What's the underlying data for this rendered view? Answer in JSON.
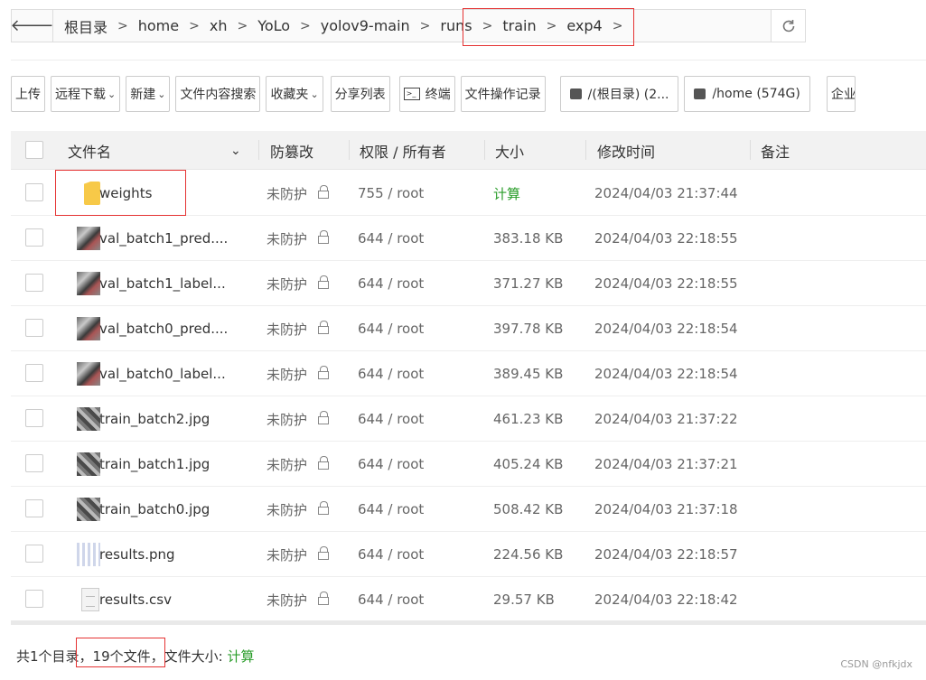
{
  "breadcrumb": {
    "items": [
      "根目录",
      "home",
      "xh",
      "YoLo",
      "yolov9-main",
      "runs",
      "train",
      "exp4"
    ]
  },
  "toolbar": {
    "upload": "上传",
    "remote_download": "远程下载",
    "new": "新建",
    "content_search": "文件内容搜索",
    "favorites": "收藏夹",
    "share_list": "分享列表",
    "terminal": "终端",
    "op_log": "文件操作记录",
    "disk_root": "/(根目录) (2...",
    "disk_home": "/home (574G)",
    "enterprise": "企业"
  },
  "table": {
    "headers": {
      "name": "文件名",
      "tamper": "防篡改",
      "perm": "权限 / 所有者",
      "size": "大小",
      "mtime": "修改时间",
      "note": "备注"
    },
    "rows": [
      {
        "name": "weights",
        "tamper": "未防护",
        "perm": "755 / root",
        "size": "计算",
        "mtime": "2024/04/03 21:37:44"
      },
      {
        "name": "val_batch1_pred....",
        "tamper": "未防护",
        "perm": "644 / root",
        "size": "383.18 KB",
        "mtime": "2024/04/03 22:18:55"
      },
      {
        "name": "val_batch1_label...",
        "tamper": "未防护",
        "perm": "644 / root",
        "size": "371.27 KB",
        "mtime": "2024/04/03 22:18:55"
      },
      {
        "name": "val_batch0_pred....",
        "tamper": "未防护",
        "perm": "644 / root",
        "size": "397.78 KB",
        "mtime": "2024/04/03 22:18:54"
      },
      {
        "name": "val_batch0_label...",
        "tamper": "未防护",
        "perm": "644 / root",
        "size": "389.45 KB",
        "mtime": "2024/04/03 22:18:54"
      },
      {
        "name": "train_batch2.jpg",
        "tamper": "未防护",
        "perm": "644 / root",
        "size": "461.23 KB",
        "mtime": "2024/04/03 21:37:22"
      },
      {
        "name": "train_batch1.jpg",
        "tamper": "未防护",
        "perm": "644 / root",
        "size": "405.24 KB",
        "mtime": "2024/04/03 21:37:21"
      },
      {
        "name": "train_batch0.jpg",
        "tamper": "未防护",
        "perm": "644 / root",
        "size": "508.42 KB",
        "mtime": "2024/04/03 21:37:18"
      },
      {
        "name": "results.png",
        "tamper": "未防护",
        "perm": "644 / root",
        "size": "224.56 KB",
        "mtime": "2024/04/03 22:18:57"
      },
      {
        "name": "results.csv",
        "tamper": "未防护",
        "perm": "644 / root",
        "size": "29.57 KB",
        "mtime": "2024/04/03 22:18:42"
      }
    ]
  },
  "footer": {
    "summary": "共1个目录，19个文件，文件大小:",
    "calc": "计算"
  },
  "watermark": "CSDN @nfkjdx",
  "colors": {
    "highlight": "#e53333",
    "accent_green": "#2a9d2a"
  }
}
